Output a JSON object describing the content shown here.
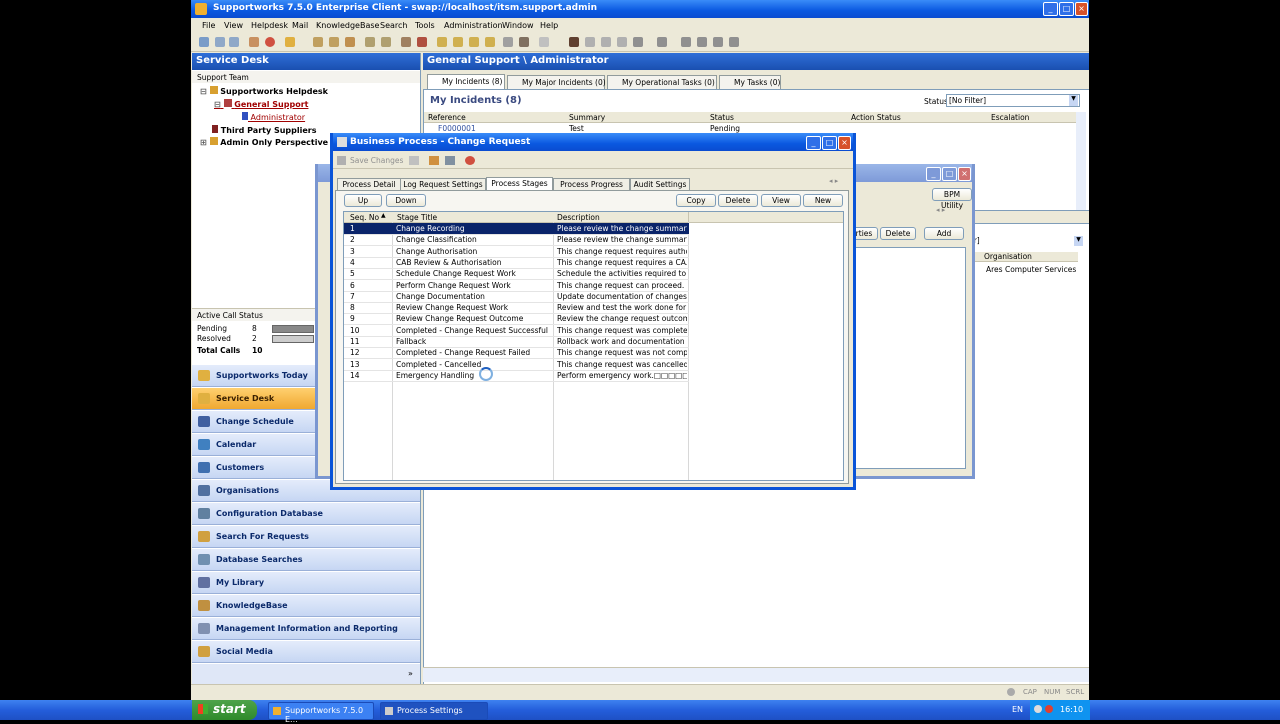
{
  "window": {
    "title": "Supportworks 7.5.0 Enterprise Client - swap://localhost/itsm.support.admin"
  },
  "menu": [
    "File",
    "View",
    "Helpdesk",
    "Mail",
    "KnowledgeBase",
    "Search",
    "Tools",
    "Administration",
    "Window",
    "Help"
  ],
  "left": {
    "title": "Service Desk",
    "section": "Support Team",
    "tree": {
      "root": "Supportworks Helpdesk",
      "group": "General Support",
      "user": "Administrator",
      "third": "Third Party Suppliers",
      "admin": "Admin Only Perspective"
    },
    "active_call_status": {
      "title": "Active Call Status",
      "pending_label": "Pending",
      "pending_value": "8",
      "resolved_label": "Resolved",
      "resolved_value": "2",
      "total_label": "Total Calls",
      "total_value": "10"
    },
    "nav": [
      "Supportworks Today",
      "Service Desk",
      "Change Schedule",
      "Calendar",
      "Customers",
      "Organisations",
      "Configuration Database",
      "Search For Requests",
      "Database Searches",
      "My Library",
      "KnowledgeBase",
      "Management Information and Reporting",
      "Social Media"
    ],
    "nav_active": "Service Desk"
  },
  "right": {
    "title": "General Support \\ Administrator",
    "tabs": [
      "My Incidents (8)",
      "My Major Incidents (0)",
      "My Operational Tasks (0)",
      "My Tasks (0)"
    ],
    "heading": "My Incidents (8)",
    "status_label": "Status :",
    "status_value": "[No Filter]",
    "columns": [
      "Reference",
      "Summary",
      "Status",
      "Action Status",
      "Escalation"
    ],
    "first_row": [
      "F0000001",
      "Test",
      "Pending"
    ],
    "lower_filter": "ilter]",
    "lower_column": "Organisation",
    "lower_value": "Ares Computer Services",
    "lower_buttons": [
      "rties",
      "Delete",
      "Add"
    ],
    "bpm_utility": "BPM Utility"
  },
  "dialog": {
    "title": "Business Process - Change Request",
    "save_changes": "Save Changes",
    "tabs": [
      "Process Detail",
      "Log Request Settings",
      "Process Stages",
      "Process Progress",
      "Audit Settings"
    ],
    "active_tab": "Process Stages",
    "buttons_left": [
      "Up",
      "Down"
    ],
    "buttons_right": [
      "Copy",
      "Delete",
      "View",
      "New"
    ],
    "columns": [
      "Seq. No",
      "Stage Title",
      "Description"
    ],
    "rows": [
      [
        "1",
        "Change Recording",
        "Please review the change summary..."
      ],
      [
        "2",
        "Change Classification",
        "Please review the change summary..."
      ],
      [
        "3",
        "Change Authorisation",
        "This change request requires autho..."
      ],
      [
        "4",
        "CAB Review & Authorisation",
        "This change request requires a CA..."
      ],
      [
        "5",
        "Schedule Change Request Work",
        "Schedule the activities required to c..."
      ],
      [
        "6",
        "Perform Change Request Work",
        "This change request can proceed. ..."
      ],
      [
        "7",
        "Change Documentation",
        "Update documentation of changes p..."
      ],
      [
        "8",
        "Review Change Request Work",
        "Review and test the work done for ..."
      ],
      [
        "9",
        "Review Change Request Outcome",
        "Review the change request outcom..."
      ],
      [
        "10",
        "Completed - Change Request Successful",
        "This change request was complete..."
      ],
      [
        "11",
        "Fallback",
        "Rollback work and documentation"
      ],
      [
        "12",
        "Completed - Change Request Failed",
        "This change request was not compl..."
      ],
      [
        "13",
        "Completed - Cancelled",
        "This change request was cancelled..."
      ],
      [
        "14",
        "Emergency Handling",
        "Perform emergency work.□□□□□□"
      ]
    ]
  },
  "statusbar": [
    "CAP",
    "NUM",
    "SCRL"
  ],
  "taskbar": {
    "start": "start",
    "tasks": [
      "Supportworks 7.5.0 E...",
      "Process Settings"
    ],
    "lang": "EN",
    "time": "16:10"
  },
  "colors": {
    "accent": "#0a246a",
    "title": "#0a58e0",
    "nav_active": "#f0a830"
  }
}
